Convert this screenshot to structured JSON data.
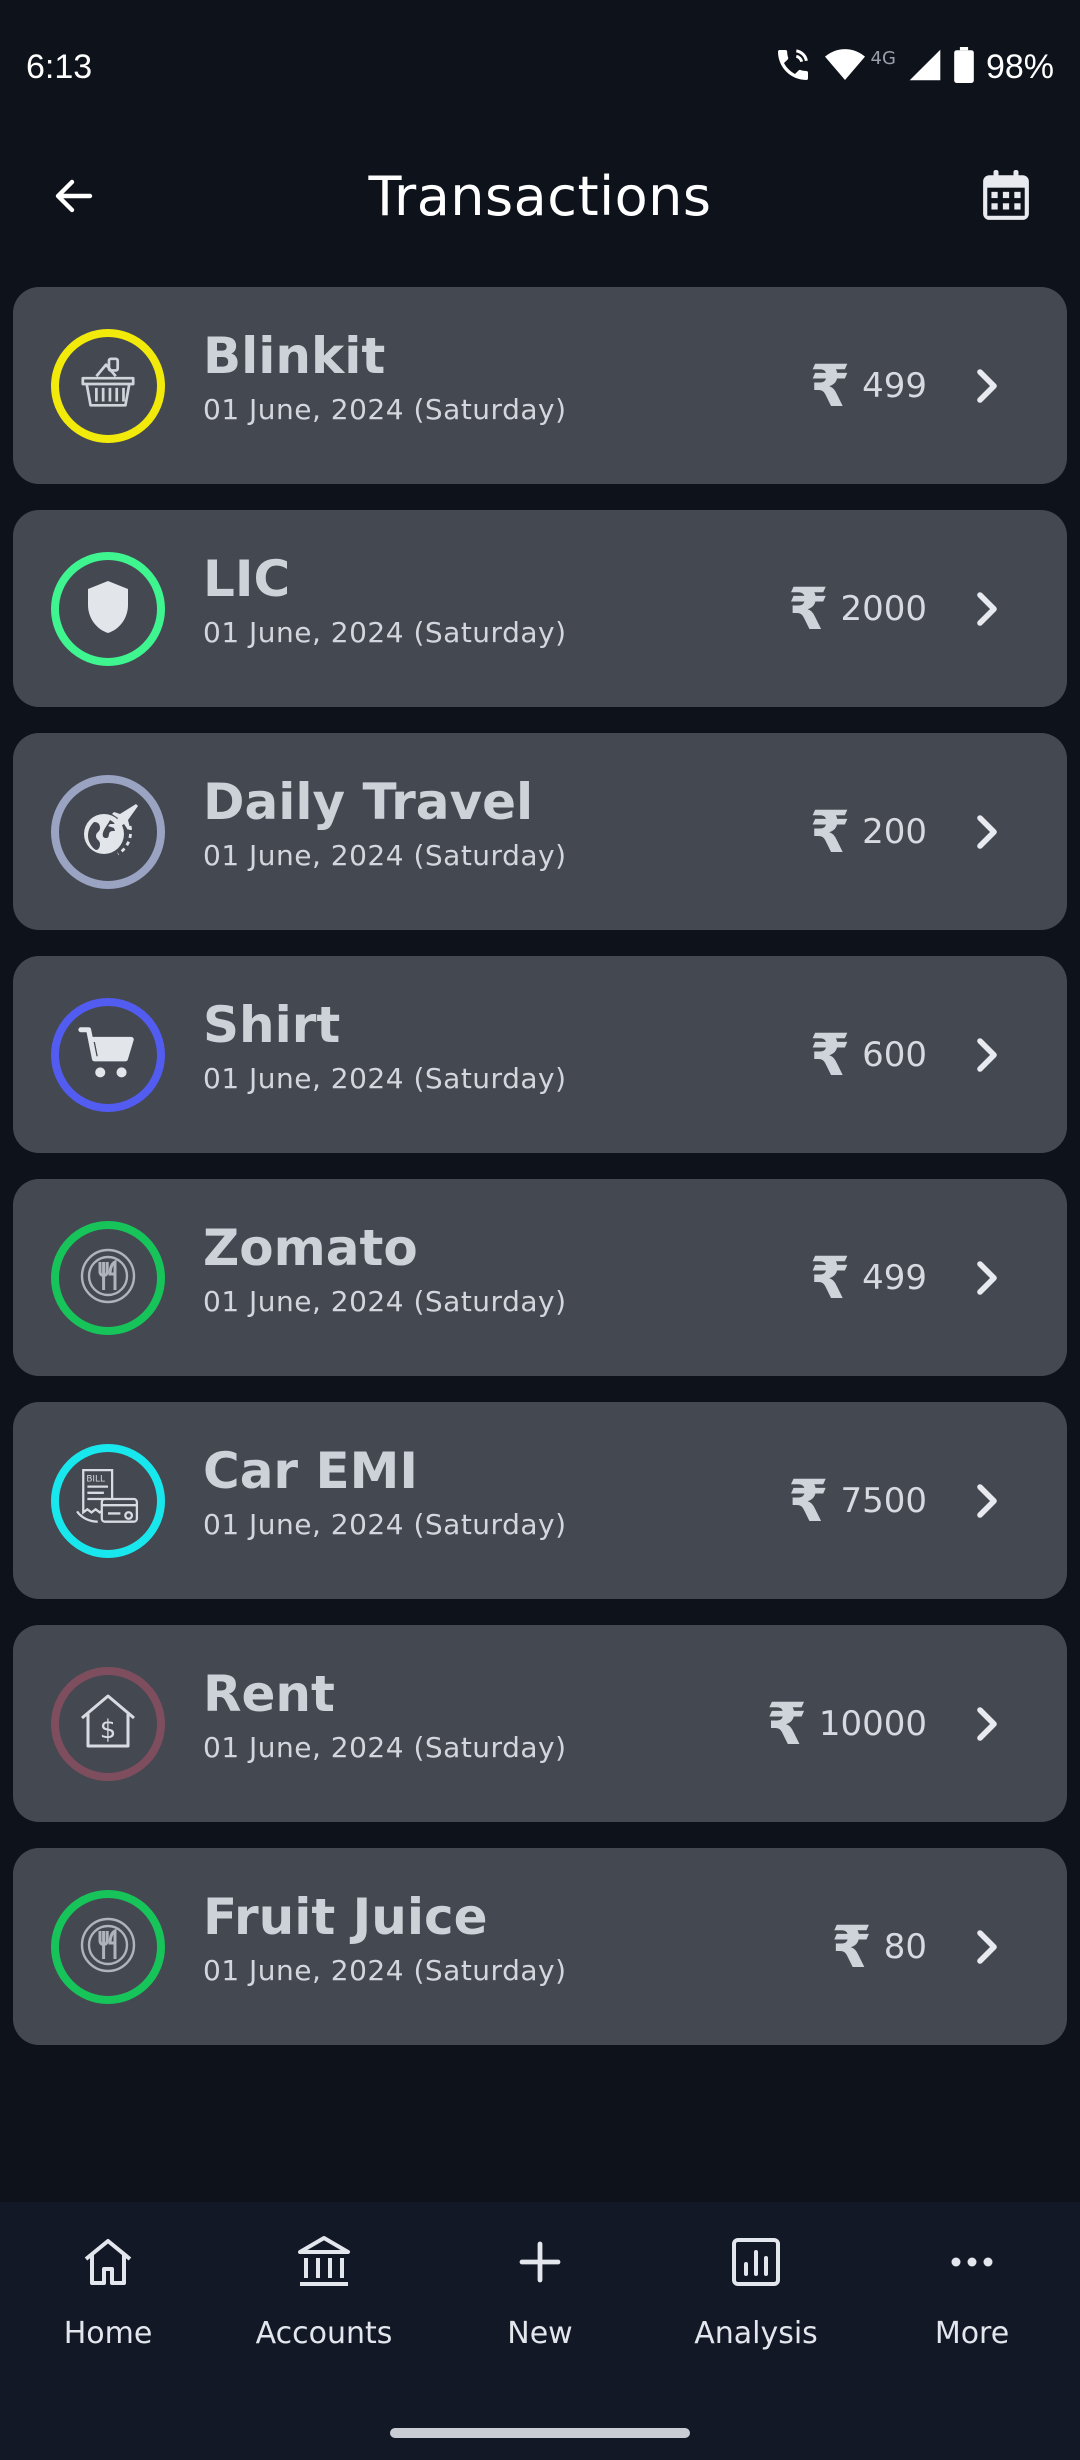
{
  "status_bar": {
    "time": "6:13",
    "network": "4G",
    "battery": "98%"
  },
  "header": {
    "title": "Transactions",
    "back_icon": "arrow-left-icon",
    "calendar_icon": "calendar-icon"
  },
  "currency_symbol": "₹",
  "transactions": [
    {
      "name": "Blinkit",
      "date": "01 June, 2024 (Saturday)",
      "amount": "499",
      "ring_color": "#f2ea0a",
      "icon": "basket-icon"
    },
    {
      "name": "LIC",
      "date": "01 June, 2024 (Saturday)",
      "amount": "2000",
      "ring_color": "#3ef58f",
      "icon": "shield-icon"
    },
    {
      "name": "Daily Travel",
      "date": "01 June, 2024 (Saturday)",
      "amount": "200",
      "ring_color": "#9aa3c2",
      "icon": "globe-plane-icon"
    },
    {
      "name": "Shirt",
      "date": "01 June, 2024 (Saturday)",
      "amount": "600",
      "ring_color": "#525cf0",
      "icon": "cart-icon"
    },
    {
      "name": "Zomato",
      "date": "01 June, 2024 (Saturday)",
      "amount": "499",
      "ring_color": "#16c45a",
      "icon": "dining-icon"
    },
    {
      "name": "Car EMI",
      "date": "01 June, 2024 (Saturday)",
      "amount": "7500",
      "ring_color": "#18e8ee",
      "icon": "bill-card-icon"
    },
    {
      "name": "Rent",
      "date": "01 June, 2024 (Saturday)",
      "amount": "10000",
      "ring_color": "#7e4e5e",
      "icon": "house-dollar-icon"
    },
    {
      "name": "Fruit Juice",
      "date": "01 June, 2024 (Saturday)",
      "amount": "80",
      "ring_color": "#16c45a",
      "icon": "dining-icon"
    }
  ],
  "bottom_nav": [
    {
      "label": "Home",
      "icon": "home-icon"
    },
    {
      "label": "Accounts",
      "icon": "bank-icon"
    },
    {
      "label": "New",
      "icon": "plus-icon"
    },
    {
      "label": "Analysis",
      "icon": "analysis-icon"
    },
    {
      "label": "More",
      "icon": "more-dots-icon"
    }
  ]
}
